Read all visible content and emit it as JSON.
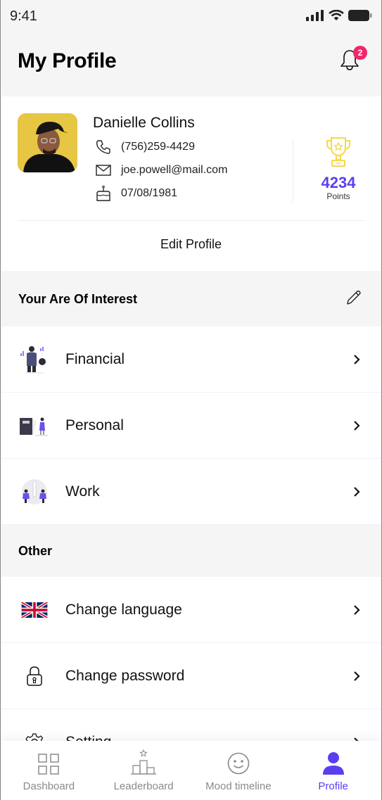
{
  "status_bar": {
    "time": "9:41"
  },
  "header": {
    "title": "My Profile",
    "notification_count": "2"
  },
  "profile": {
    "name": "Danielle Collins",
    "phone": "(756)259-4429",
    "email": "joe.powell@mail.com",
    "birthday": "07/08/1981",
    "points_value": "4234",
    "points_label": "Points",
    "edit_label": "Edit Profile"
  },
  "interest_section": {
    "title": "Your Are Of Interest",
    "items": [
      {
        "label": "Financial",
        "icon": "financial-illustration"
      },
      {
        "label": "Personal",
        "icon": "personal-illustration"
      },
      {
        "label": "Work",
        "icon": "work-illustration"
      }
    ]
  },
  "other_section": {
    "title": "Other",
    "items": [
      {
        "label": "Change language",
        "icon": "uk-flag"
      },
      {
        "label": "Change password",
        "icon": "lock"
      },
      {
        "label": "Setting",
        "icon": "gear"
      }
    ]
  },
  "bottom_nav": {
    "items": [
      {
        "label": "Dashboard",
        "icon": "grid"
      },
      {
        "label": "Leaderboard",
        "icon": "podium"
      },
      {
        "label": "Mood timeline",
        "icon": "smiley"
      },
      {
        "label": "Profile",
        "icon": "person",
        "active": true
      }
    ]
  },
  "colors": {
    "accent": "#5b3ef0",
    "badge": "#f2266a",
    "trophy": "#f5d94a",
    "background": "#f5f5f5"
  }
}
